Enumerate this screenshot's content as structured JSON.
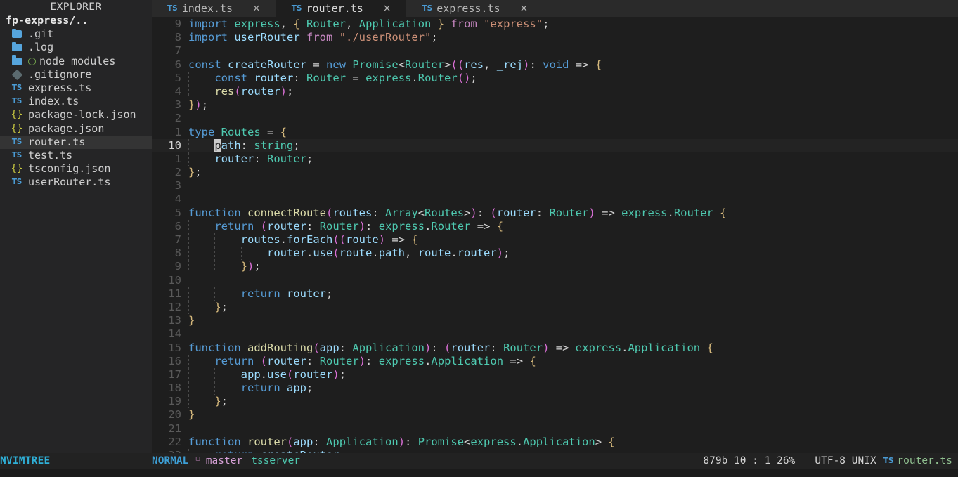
{
  "sidebar": {
    "title": "EXPLORER",
    "root": "fp-express/..",
    "items": [
      {
        "name": ".git",
        "icon": "folder-icon",
        "kind": "folder",
        "selected": false,
        "git": false
      },
      {
        "name": ".log",
        "icon": "folder-icon",
        "kind": "folder",
        "selected": false,
        "git": false
      },
      {
        "name": "node_modules",
        "icon": "folder-icon",
        "kind": "folder",
        "selected": false,
        "git": true
      },
      {
        "name": ".gitignore",
        "icon": "gem-icon",
        "kind": "file",
        "selected": false,
        "git": false
      },
      {
        "name": "express.ts",
        "icon": "typescript-icon",
        "kind": "file",
        "selected": false,
        "git": false
      },
      {
        "name": "index.ts",
        "icon": "typescript-icon",
        "kind": "file",
        "selected": false,
        "git": false
      },
      {
        "name": "package-lock.json",
        "icon": "json-icon",
        "kind": "file",
        "selected": false,
        "git": false
      },
      {
        "name": "package.json",
        "icon": "json-icon",
        "kind": "file",
        "selected": false,
        "git": false
      },
      {
        "name": "router.ts",
        "icon": "typescript-icon",
        "kind": "file",
        "selected": true,
        "git": false
      },
      {
        "name": "test.ts",
        "icon": "typescript-icon",
        "kind": "file",
        "selected": false,
        "git": false
      },
      {
        "name": "tsconfig.json",
        "icon": "json-icon",
        "kind": "file",
        "selected": false,
        "git": false
      },
      {
        "name": "userRouter.ts",
        "icon": "typescript-icon",
        "kind": "file",
        "selected": false,
        "git": false
      }
    ]
  },
  "tabs": [
    {
      "label": "index.ts",
      "icon": "typescript-icon",
      "close": "×",
      "active": false
    },
    {
      "label": "router.ts",
      "icon": "typescript-icon",
      "close": "×",
      "active": true
    },
    {
      "label": "express.ts",
      "icon": "typescript-icon",
      "close": "×",
      "active": false
    }
  ],
  "editor": {
    "cursor_line_number": "10",
    "cursor_char": "p",
    "lines": [
      {
        "num": "9",
        "text": "import express, { Router, Application } from \"express\";"
      },
      {
        "num": "8",
        "text": "import userRouter from \"./userRouter\";"
      },
      {
        "num": "7",
        "text": ""
      },
      {
        "num": "6",
        "text": "const createRouter = new Promise<Router>((res, _rej): void => {"
      },
      {
        "num": "5",
        "text": "    const router: Router = express.Router();"
      },
      {
        "num": "4",
        "text": "    res(router);"
      },
      {
        "num": "3",
        "text": "});"
      },
      {
        "num": "2",
        "text": ""
      },
      {
        "num": "1",
        "text": "type Routes = {"
      },
      {
        "num": "10",
        "text": "    path: string;"
      },
      {
        "num": "1",
        "text": "    router: Router;"
      },
      {
        "num": "2",
        "text": "};"
      },
      {
        "num": "3",
        "text": ""
      },
      {
        "num": "4",
        "text": ""
      },
      {
        "num": "5",
        "text": "function connectRoute(routes: Array<Routes>): (router: Router) => express.Router {"
      },
      {
        "num": "6",
        "text": "    return (router: Router): express.Router => {"
      },
      {
        "num": "7",
        "text": "        routes.forEach((route) => {"
      },
      {
        "num": "8",
        "text": "            router.use(route.path, route.router);"
      },
      {
        "num": "9",
        "text": "        });"
      },
      {
        "num": "10",
        "text": ""
      },
      {
        "num": "11",
        "text": "        return router;"
      },
      {
        "num": "12",
        "text": "    };"
      },
      {
        "num": "13",
        "text": "}"
      },
      {
        "num": "14",
        "text": ""
      },
      {
        "num": "15",
        "text": "function addRouting(app: Application): (router: Router) => express.Application {"
      },
      {
        "num": "16",
        "text": "    return (router: Router): express.Application => {"
      },
      {
        "num": "17",
        "text": "        app.use(router);"
      },
      {
        "num": "18",
        "text": "        return app;"
      },
      {
        "num": "19",
        "text": "    };"
      },
      {
        "num": "20",
        "text": "}"
      },
      {
        "num": "21",
        "text": ""
      },
      {
        "num": "22",
        "text": "function router(app: Application): Promise<express.Application> {"
      },
      {
        "num": "23",
        "text": "    return createRouter"
      }
    ]
  },
  "statusline": {
    "tree_label": "NVIMTREE",
    "mode": "NORMAL",
    "branch_icon": " ",
    "branch": "master",
    "lsp": "tsserver",
    "position": "879b 10 : 1 26%",
    "encoding": "UTF-8 UNIX",
    "file_icon": "typescript-icon",
    "filename": "router.ts"
  },
  "colors": {
    "editor_bg": "#1e1e1e",
    "sidebar_bg": "#252526",
    "tabline_bg": "#2a2a2a",
    "statusline_bg": "#222222",
    "accent_blue": "#4a9bd4",
    "accent_green": "#4ec9b0",
    "selection_bg": "#343434"
  }
}
